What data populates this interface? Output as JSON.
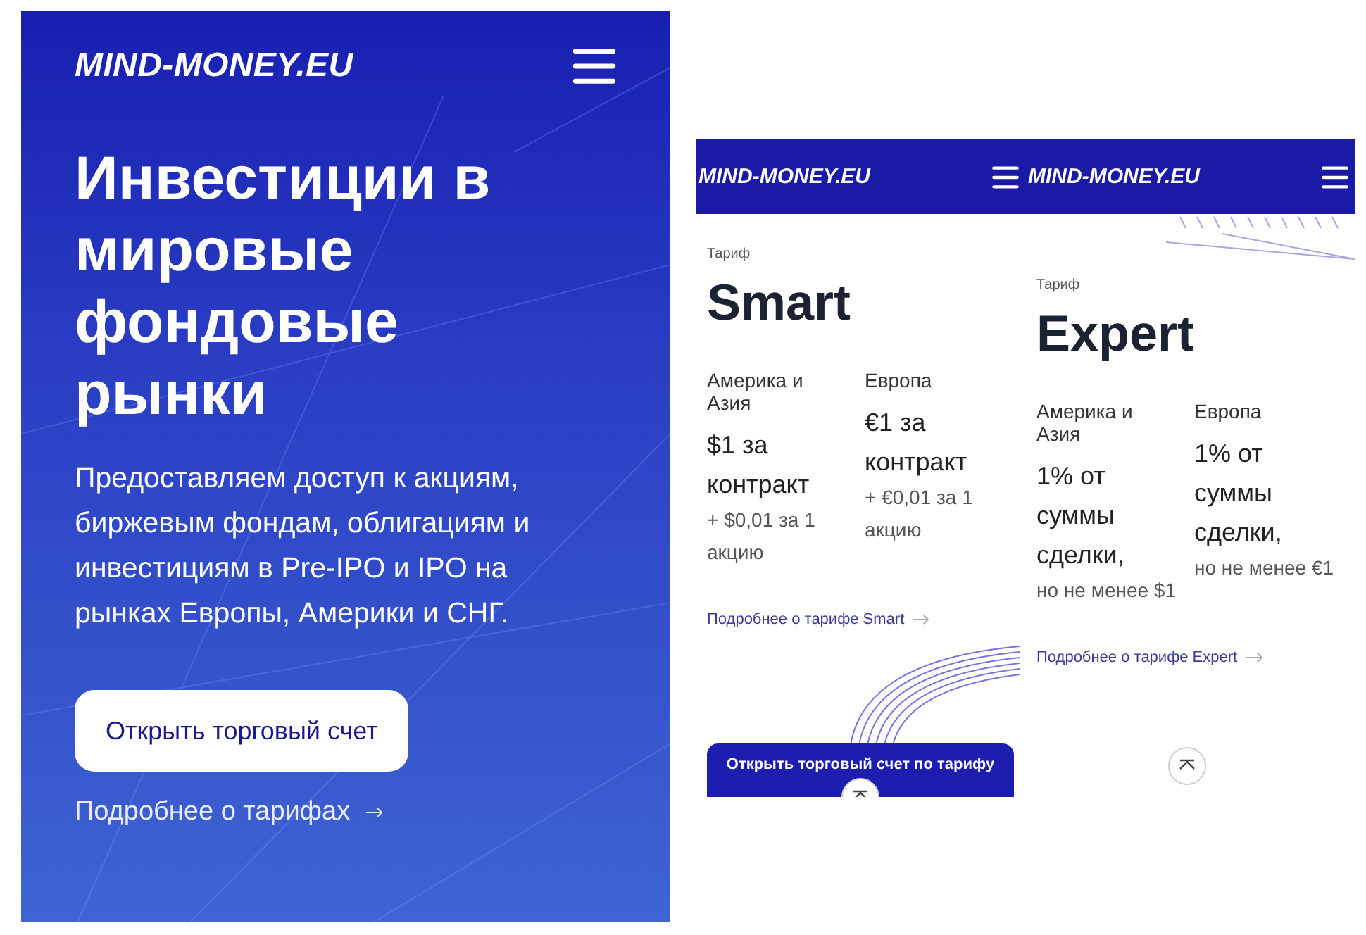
{
  "screens": [
    {
      "kind": "hero",
      "logo": "MIND-MONEY.EU",
      "title": "Инвестиции в мировые фондовые рынки",
      "description": "Предоставляем доступ к акциям, биржевым фондам, облигациям и  инвестициям в Pre-IPO и IPO на рынках Европы, Америки и СНГ.",
      "button": "Открыть торговый счет",
      "link": "Подробнее о тарифах"
    },
    {
      "kind": "tariff",
      "logo": "MIND-MONEY.EU",
      "label": "Тариф",
      "name": "Smart",
      "regions": [
        {
          "name": "Америка и Азия",
          "price": "$1 за контракт",
          "note": "+ $0,01 за 1 акцию"
        },
        {
          "name": "Европа",
          "price": "€1 за контракт",
          "note": "+ €0,01 за 1 акцию"
        }
      ],
      "link": "Подробнее о тарифе Smart",
      "button": "Открыть торговый счет по тарифу"
    },
    {
      "kind": "tariff",
      "logo": "MIND-MONEY.EU",
      "label": "Тариф",
      "name": "Expert",
      "regions": [
        {
          "name": "Америка и Азия",
          "price": "1% от суммы сделки,",
          "note": "но не менее $1"
        },
        {
          "name": "Европа",
          "price": "1% от суммы сделки,",
          "note": "но не менее €1"
        }
      ],
      "link": "Подробнее о тарифе Expert"
    }
  ]
}
